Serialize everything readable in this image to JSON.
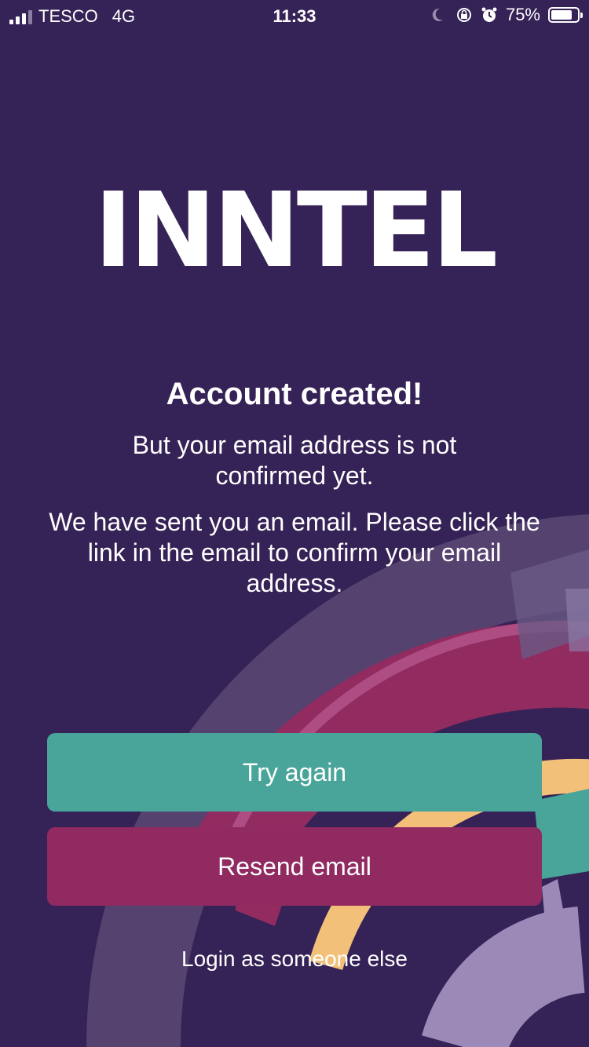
{
  "status_bar": {
    "carrier": "TESCO",
    "network": "4G",
    "time": "11:33",
    "battery": "75%",
    "icons": [
      "moon-icon",
      "rotation-lock-icon",
      "alarm-icon",
      "battery-icon"
    ]
  },
  "logo_text": "INNTEL",
  "heading": "Account created!",
  "message_primary": "But your email address is not confirmed yet.",
  "message_secondary": "We have sent you an email. Please click the link in the email to confirm your email address.",
  "buttons": {
    "try_again": "Try again",
    "resend_email": "Resend email"
  },
  "login_other": "Login as someone else",
  "colors": {
    "background": "#352256",
    "try_again": "#49a49a",
    "resend_email": "#902a61",
    "accent_yellow": "#f3c07a",
    "accent_lavender": "#9c89b8"
  }
}
